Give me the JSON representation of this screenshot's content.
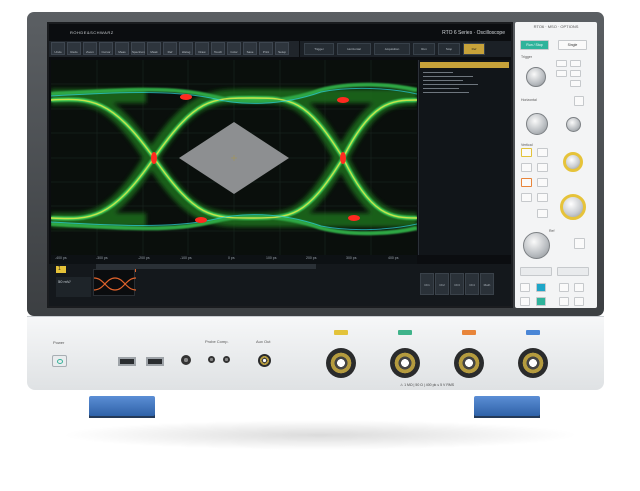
{
  "device": {
    "brand": "ROHDE&SCHWARZ",
    "title": "RTO 6 Series · Oscilloscope"
  },
  "toolbar": {
    "labels": [
      "Undo",
      "Redo",
      "Zoom",
      "Cursor",
      "Meas",
      "Spectrum",
      "Mask",
      "Ref",
      "Histog",
      "Draw",
      "Touch",
      "Color",
      "Save",
      "Print",
      "Setup"
    ]
  },
  "right_toolbar": {
    "labels": [
      "Trigger",
      "Horizontal",
      "Acquisition",
      "Run",
      "Stop",
      "Ref"
    ]
  },
  "x_axis": {
    "labels": [
      "-400 ps",
      "-300 ps",
      "-200 ps",
      "-100 ps",
      "0 ps",
      "100 ps",
      "200 ps",
      "300 ps",
      "400 ps"
    ]
  },
  "channel_badge": "1",
  "measurement_box": "50 mV/",
  "bottom_buttons": [
    "Ch1",
    "Ch2",
    "Ch3",
    "Ch4",
    "Math"
  ],
  "control_panel": {
    "header": "RTO6 · MSO · OPTIONS",
    "run_stop": "Run / Stop",
    "single": "Single",
    "sections": [
      "Trigger",
      "Horizontal",
      "Vertical",
      "Ref",
      "Bus"
    ],
    "keys": [
      "Setup",
      "Auto",
      "Ch1",
      "Ch2",
      "Ch3",
      "Ch4",
      "M",
      "R",
      "Menu"
    ]
  },
  "front_panel": {
    "power": "Power",
    "probe_comp": "Probe Comp.",
    "aux_out": "Aux Out",
    "warning": "⚠ 1 MΩ | 50 Ω | 400 pk ≤ 5 V RMS"
  },
  "channel_colors": [
    "#e3c33a",
    "#3fb38a",
    "#e8853a",
    "#4a86d6"
  ],
  "accent": "#e5c238"
}
